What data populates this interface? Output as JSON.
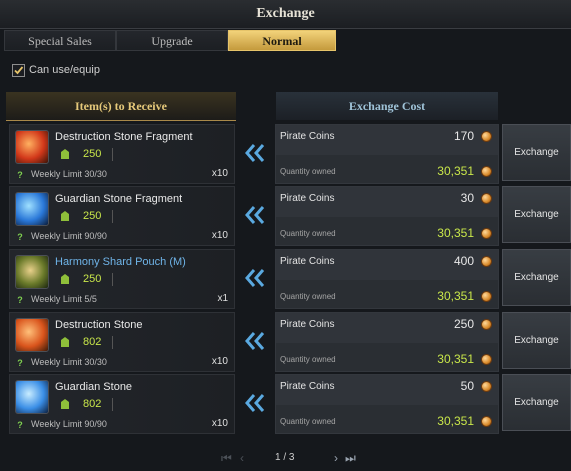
{
  "window": {
    "title": "Exchange"
  },
  "tabs": [
    {
      "label": "Special Sales"
    },
    {
      "label": "Upgrade"
    },
    {
      "label": "Normal"
    }
  ],
  "filter": {
    "label": "Can use/equip",
    "checked": true
  },
  "headers": {
    "receive": "Item(s) to Receive",
    "cost": "Exchange Cost"
  },
  "rows": [
    {
      "name": "Destruction Stone Fragment",
      "name_color": "#e9e9e9",
      "icon": "destruction-stone-fragment-icon",
      "level": "250",
      "limit": "Weekly Limit 30/30",
      "qty": "x10",
      "currency": "Pirate Coins",
      "cost": "170",
      "owned_label": "Quantity owned",
      "owned": "30,351",
      "button": "Exchange"
    },
    {
      "name": "Guardian Stone Fragment",
      "name_color": "#e9e9e9",
      "icon": "guardian-stone-fragment-icon",
      "level": "250",
      "limit": "Weekly Limit 90/90",
      "qty": "x10",
      "currency": "Pirate Coins",
      "cost": "30",
      "owned_label": "Quantity owned",
      "owned": "30,351",
      "button": "Exchange"
    },
    {
      "name": "Harmony Shard Pouch (M)",
      "name_color": "#6fb4e8",
      "icon": "harmony-shard-pouch-icon",
      "level": "250",
      "limit": "Weekly Limit 5/5",
      "qty": "x1",
      "currency": "Pirate Coins",
      "cost": "400",
      "owned_label": "Quantity owned",
      "owned": "30,351",
      "button": "Exchange"
    },
    {
      "name": "Destruction Stone",
      "name_color": "#e9e9e9",
      "icon": "destruction-stone-icon",
      "level": "802",
      "limit": "Weekly Limit 30/30",
      "qty": "x10",
      "currency": "Pirate Coins",
      "cost": "250",
      "owned_label": "Quantity owned",
      "owned": "30,351",
      "button": "Exchange"
    },
    {
      "name": "Guardian Stone",
      "name_color": "#e9e9e9",
      "icon": "guardian-stone-icon",
      "level": "802",
      "limit": "Weekly Limit 90/90",
      "qty": "x10",
      "currency": "Pirate Coins",
      "cost": "50",
      "owned_label": "Quantity owned",
      "owned": "30,351",
      "button": "Exchange"
    }
  ],
  "pagination": {
    "text": "1 / 3"
  },
  "colors": {
    "accent_gold": "#e6c46a",
    "level_green": "#c9e74a",
    "blue_item": "#6fb4e8",
    "arrow_blue": "#5aa9e0"
  }
}
